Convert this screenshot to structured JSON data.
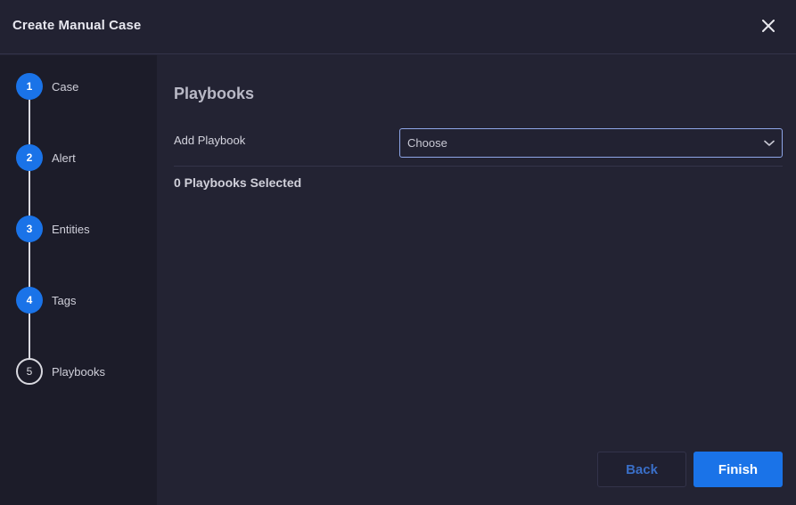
{
  "header": {
    "title": "Create Manual Case",
    "close_icon": "close-icon"
  },
  "steps": [
    {
      "number": "1",
      "label": "Case",
      "state": "completed"
    },
    {
      "number": "2",
      "label": "Alert",
      "state": "completed"
    },
    {
      "number": "3",
      "label": "Entities",
      "state": "completed"
    },
    {
      "number": "4",
      "label": "Tags",
      "state": "completed"
    },
    {
      "number": "5",
      "label": "Playbooks",
      "state": "current"
    }
  ],
  "main": {
    "section_title": "Playbooks",
    "add_playbook_label": "Add Playbook",
    "select_value": "Choose",
    "selected_count": "0 Playbooks Selected"
  },
  "footer": {
    "back_label": "Back",
    "finish_label": "Finish"
  },
  "colors": {
    "accent": "#1a73e8",
    "background": "#232333",
    "sidebar": "#1c1c29"
  }
}
